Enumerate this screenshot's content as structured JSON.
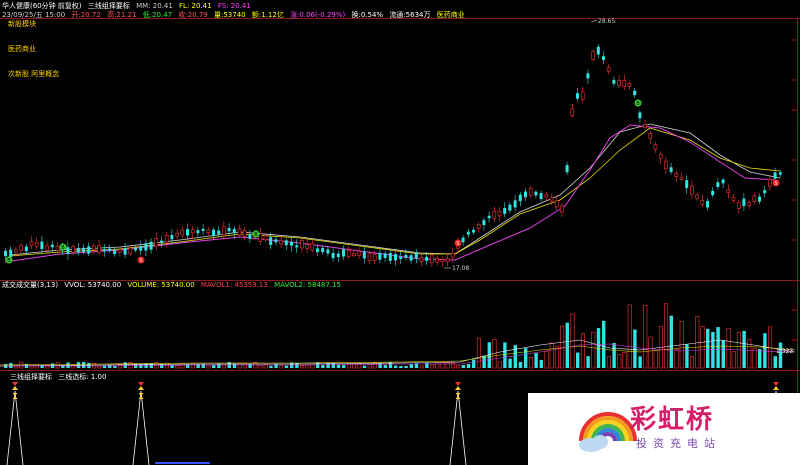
{
  "header1": {
    "stock": "华人健康(60分钟 前复权)",
    "indicator": "三线组择要标",
    "mm": "MM: 20.41",
    "fl": "FL: 20.41",
    "fs": "FS: 20.41"
  },
  "header2": {
    "date": "23/09/25/五 15:00",
    "open": "开:20.72",
    "high": "高:21.21",
    "low": "低:20.47",
    "close": "收:20.79",
    "vol": "量:53740",
    "amount": "额:1.12亿",
    "change": "涨:0.06(-0.29%)",
    "turnover": "换:0.54%",
    "float": "流通:5634万",
    "sector": "医药商业"
  },
  "tags": [
    "新股模块",
    "医药商业",
    "次新股 阿里概念"
  ],
  "price_labels": {
    "high": "28.65",
    "low": "17.08"
  },
  "vol_header": {
    "title": "成交成交量(3,13)",
    "vvol": "VVOL: 53740.00",
    "volume": "VOLUME: 53740.00",
    "mavol1": "MAVOL1: 45359.13",
    "mavol2": "MAVOL2: 58487.15"
  },
  "vol_value": "1.323",
  "ind_header": {
    "title": "三线组择要标",
    "value": "三线选标: 1.00"
  },
  "watermark": {
    "brand": "彩虹桥",
    "sub": "投资充电站"
  },
  "colors": {
    "up": "#ff3333",
    "down": "#33e3e3",
    "ma1": "#e0e0e0",
    "ma2": "#e8e000",
    "ma3": "#e040e0"
  }
}
